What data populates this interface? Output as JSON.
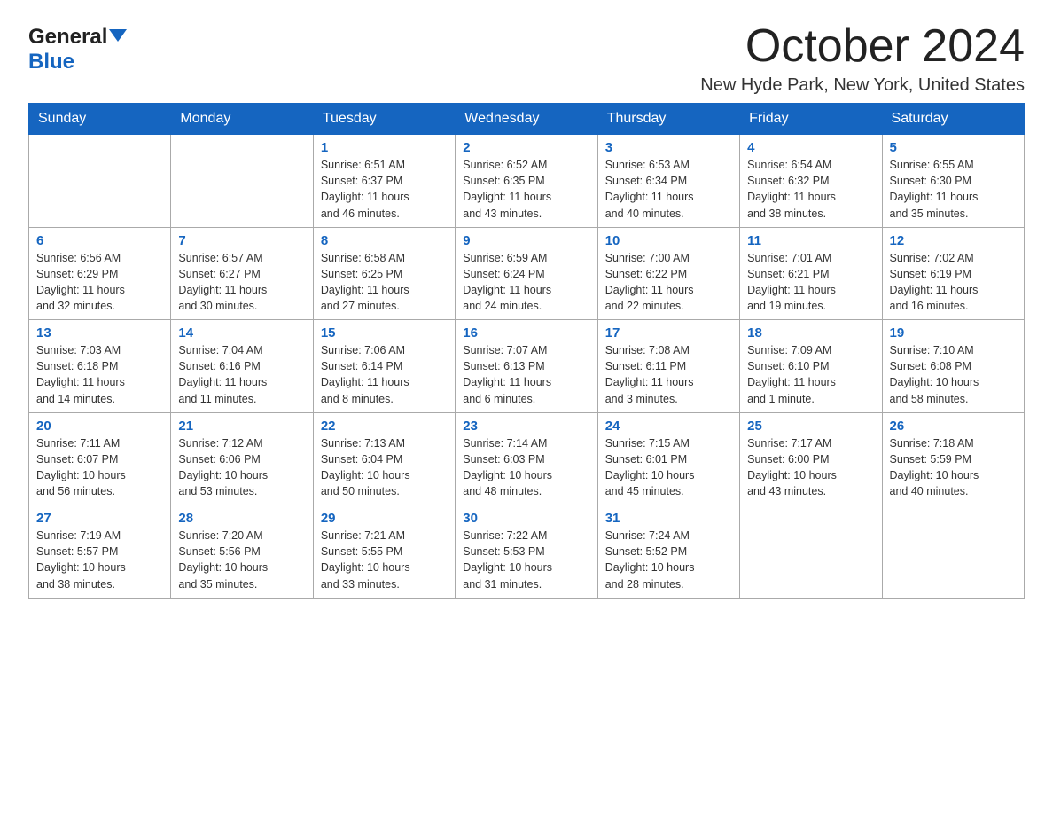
{
  "header": {
    "logo_general": "General",
    "logo_blue": "Blue",
    "month": "October 2024",
    "location": "New Hyde Park, New York, United States"
  },
  "weekdays": [
    "Sunday",
    "Monday",
    "Tuesday",
    "Wednesday",
    "Thursday",
    "Friday",
    "Saturday"
  ],
  "weeks": [
    [
      {
        "day": "",
        "info": ""
      },
      {
        "day": "",
        "info": ""
      },
      {
        "day": "1",
        "info": "Sunrise: 6:51 AM\nSunset: 6:37 PM\nDaylight: 11 hours\nand 46 minutes."
      },
      {
        "day": "2",
        "info": "Sunrise: 6:52 AM\nSunset: 6:35 PM\nDaylight: 11 hours\nand 43 minutes."
      },
      {
        "day": "3",
        "info": "Sunrise: 6:53 AM\nSunset: 6:34 PM\nDaylight: 11 hours\nand 40 minutes."
      },
      {
        "day": "4",
        "info": "Sunrise: 6:54 AM\nSunset: 6:32 PM\nDaylight: 11 hours\nand 38 minutes."
      },
      {
        "day": "5",
        "info": "Sunrise: 6:55 AM\nSunset: 6:30 PM\nDaylight: 11 hours\nand 35 minutes."
      }
    ],
    [
      {
        "day": "6",
        "info": "Sunrise: 6:56 AM\nSunset: 6:29 PM\nDaylight: 11 hours\nand 32 minutes."
      },
      {
        "day": "7",
        "info": "Sunrise: 6:57 AM\nSunset: 6:27 PM\nDaylight: 11 hours\nand 30 minutes."
      },
      {
        "day": "8",
        "info": "Sunrise: 6:58 AM\nSunset: 6:25 PM\nDaylight: 11 hours\nand 27 minutes."
      },
      {
        "day": "9",
        "info": "Sunrise: 6:59 AM\nSunset: 6:24 PM\nDaylight: 11 hours\nand 24 minutes."
      },
      {
        "day": "10",
        "info": "Sunrise: 7:00 AM\nSunset: 6:22 PM\nDaylight: 11 hours\nand 22 minutes."
      },
      {
        "day": "11",
        "info": "Sunrise: 7:01 AM\nSunset: 6:21 PM\nDaylight: 11 hours\nand 19 minutes."
      },
      {
        "day": "12",
        "info": "Sunrise: 7:02 AM\nSunset: 6:19 PM\nDaylight: 11 hours\nand 16 minutes."
      }
    ],
    [
      {
        "day": "13",
        "info": "Sunrise: 7:03 AM\nSunset: 6:18 PM\nDaylight: 11 hours\nand 14 minutes."
      },
      {
        "day": "14",
        "info": "Sunrise: 7:04 AM\nSunset: 6:16 PM\nDaylight: 11 hours\nand 11 minutes."
      },
      {
        "day": "15",
        "info": "Sunrise: 7:06 AM\nSunset: 6:14 PM\nDaylight: 11 hours\nand 8 minutes."
      },
      {
        "day": "16",
        "info": "Sunrise: 7:07 AM\nSunset: 6:13 PM\nDaylight: 11 hours\nand 6 minutes."
      },
      {
        "day": "17",
        "info": "Sunrise: 7:08 AM\nSunset: 6:11 PM\nDaylight: 11 hours\nand 3 minutes."
      },
      {
        "day": "18",
        "info": "Sunrise: 7:09 AM\nSunset: 6:10 PM\nDaylight: 11 hours\nand 1 minute."
      },
      {
        "day": "19",
        "info": "Sunrise: 7:10 AM\nSunset: 6:08 PM\nDaylight: 10 hours\nand 58 minutes."
      }
    ],
    [
      {
        "day": "20",
        "info": "Sunrise: 7:11 AM\nSunset: 6:07 PM\nDaylight: 10 hours\nand 56 minutes."
      },
      {
        "day": "21",
        "info": "Sunrise: 7:12 AM\nSunset: 6:06 PM\nDaylight: 10 hours\nand 53 minutes."
      },
      {
        "day": "22",
        "info": "Sunrise: 7:13 AM\nSunset: 6:04 PM\nDaylight: 10 hours\nand 50 minutes."
      },
      {
        "day": "23",
        "info": "Sunrise: 7:14 AM\nSunset: 6:03 PM\nDaylight: 10 hours\nand 48 minutes."
      },
      {
        "day": "24",
        "info": "Sunrise: 7:15 AM\nSunset: 6:01 PM\nDaylight: 10 hours\nand 45 minutes."
      },
      {
        "day": "25",
        "info": "Sunrise: 7:17 AM\nSunset: 6:00 PM\nDaylight: 10 hours\nand 43 minutes."
      },
      {
        "day": "26",
        "info": "Sunrise: 7:18 AM\nSunset: 5:59 PM\nDaylight: 10 hours\nand 40 minutes."
      }
    ],
    [
      {
        "day": "27",
        "info": "Sunrise: 7:19 AM\nSunset: 5:57 PM\nDaylight: 10 hours\nand 38 minutes."
      },
      {
        "day": "28",
        "info": "Sunrise: 7:20 AM\nSunset: 5:56 PM\nDaylight: 10 hours\nand 35 minutes."
      },
      {
        "day": "29",
        "info": "Sunrise: 7:21 AM\nSunset: 5:55 PM\nDaylight: 10 hours\nand 33 minutes."
      },
      {
        "day": "30",
        "info": "Sunrise: 7:22 AM\nSunset: 5:53 PM\nDaylight: 10 hours\nand 31 minutes."
      },
      {
        "day": "31",
        "info": "Sunrise: 7:24 AM\nSunset: 5:52 PM\nDaylight: 10 hours\nand 28 minutes."
      },
      {
        "day": "",
        "info": ""
      },
      {
        "day": "",
        "info": ""
      }
    ]
  ]
}
